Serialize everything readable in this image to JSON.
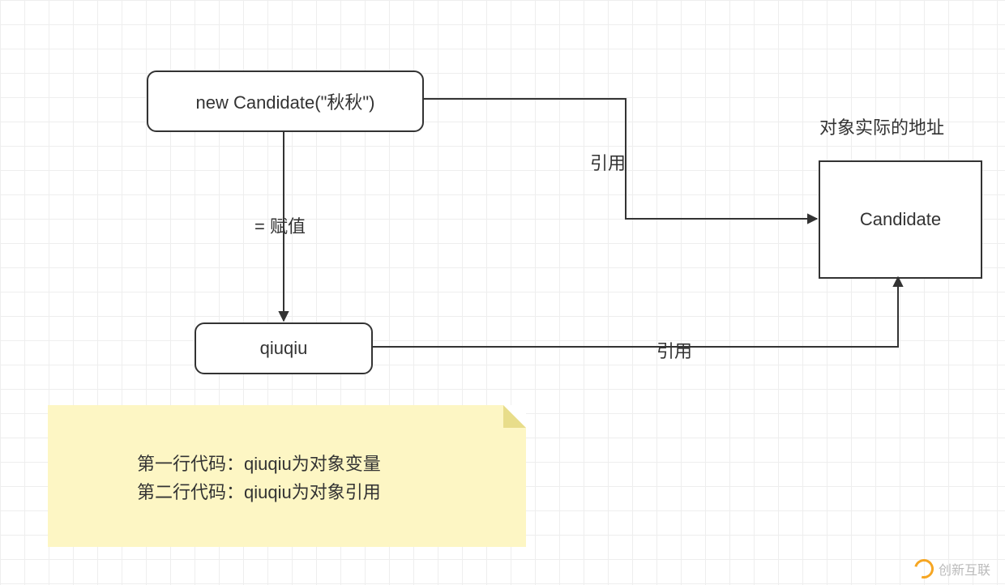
{
  "chart_data": {
    "type": "diagram",
    "nodes": [
      {
        "id": "constructor",
        "label": "new Candidate(\"秋秋\")",
        "shape": "rounded-rect"
      },
      {
        "id": "variable",
        "label": "qiuqiu",
        "shape": "rounded-rect"
      },
      {
        "id": "object",
        "label": "Candidate",
        "shape": "rect"
      }
    ],
    "edges": [
      {
        "from": "constructor",
        "to": "variable",
        "label": "= 赋值"
      },
      {
        "from": "constructor",
        "to": "object",
        "label": "引用"
      },
      {
        "from": "variable",
        "to": "object",
        "label": "引用"
      }
    ],
    "annotations": [
      {
        "target": "object",
        "text": "对象实际的地址"
      }
    ],
    "note": {
      "lines": [
        "第一行代码：qiuqiu为对象变量",
        "第二行代码：qiuqiu为对象引用"
      ]
    }
  },
  "nodes": {
    "constructor": "new Candidate(\"秋秋\")",
    "variable": "qiuqiu",
    "object": "Candidate"
  },
  "labels": {
    "assign": "= 赋值",
    "ref1": "引用",
    "ref2": "引用",
    "objectAddress": "对象实际的地址"
  },
  "note": {
    "line1": "第一行代码：qiuqiu为对象变量",
    "line2": "第二行代码：qiuqiu为对象引用"
  },
  "watermark": "创新互联"
}
